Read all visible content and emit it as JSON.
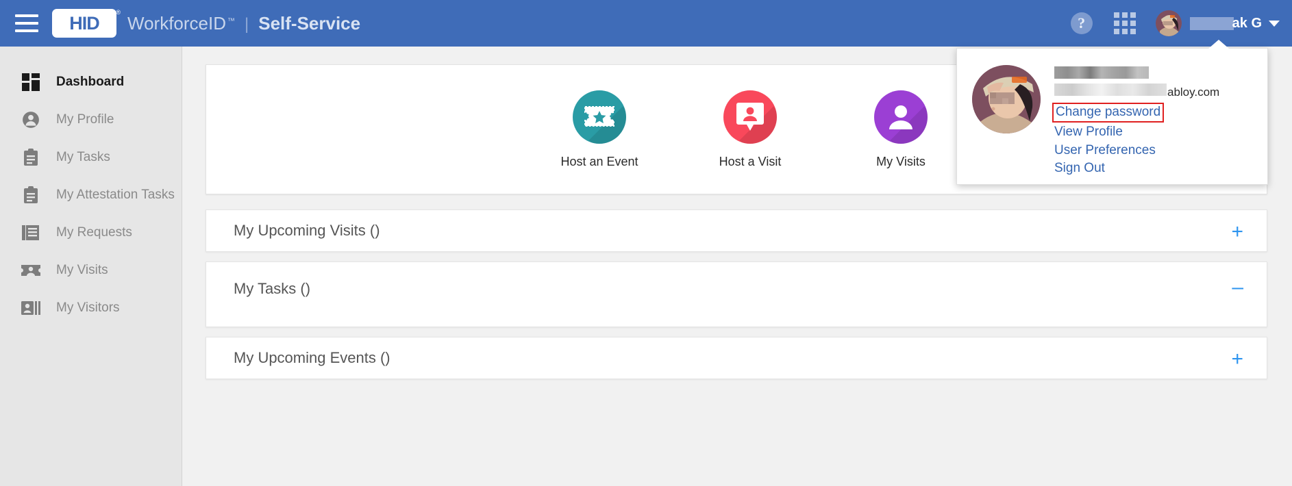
{
  "header": {
    "menu_icon": "hamburger-menu-icon",
    "logo_text": "HID",
    "logo_registered": "®",
    "product_name": "WorkforceID",
    "trademark": "™",
    "separator": "|",
    "subtitle": "Self-Service",
    "help_icon": "help-question-icon",
    "help_glyph": "?",
    "apps_icon": "apps-grid-icon",
    "avatar_icon": "user-avatar-image",
    "user_name_redacted": "",
    "user_name_visible": "ak G",
    "caret_icon": "chevron-down-icon"
  },
  "sidebar": {
    "items": [
      {
        "label": "Dashboard",
        "icon": "dashboard-grid-icon",
        "active": true
      },
      {
        "label": "My Profile",
        "icon": "person-circle-icon",
        "active": false
      },
      {
        "label": "My Tasks",
        "icon": "clipboard-icon",
        "active": false
      },
      {
        "label": "My Attestation Tasks",
        "icon": "clipboard-icon",
        "active": false
      },
      {
        "label": "My Requests",
        "icon": "documents-icon",
        "active": false
      },
      {
        "label": "My Visits",
        "icon": "badge-ticket-icon",
        "active": false
      },
      {
        "label": "My Visitors",
        "icon": "contact-card-icon",
        "active": false
      }
    ]
  },
  "main": {
    "tiles": [
      {
        "label": "Host an Event",
        "icon": "ticket-star-icon",
        "color": "#2a9ca5"
      },
      {
        "label": "Host a Visit",
        "icon": "visitor-badge-icon",
        "color": "#f9485b"
      },
      {
        "label": "My Visits",
        "icon": "person-icon",
        "color": "#9b3fd4"
      }
    ],
    "accordions": [
      {
        "title": "My Upcoming Visits ()",
        "state": "collapsed",
        "toggle": "+",
        "toggle_icon": "plus-icon"
      },
      {
        "title": "My Tasks ()",
        "state": "expanded",
        "toggle": "–",
        "toggle_icon": "minus-icon"
      },
      {
        "title": "My Upcoming Events ()",
        "state": "collapsed",
        "toggle": "+",
        "toggle_icon": "plus-icon"
      }
    ]
  },
  "dropdown": {
    "avatar_icon": "user-avatar-image",
    "name_redacted": "",
    "email_redacted": "",
    "email_visible": "abloy.com",
    "links": [
      {
        "label": "Change password",
        "highlighted": true
      },
      {
        "label": "View Profile",
        "highlighted": false
      },
      {
        "label": "User Preferences",
        "highlighted": false
      },
      {
        "label": "Sign Out",
        "highlighted": false
      }
    ]
  },
  "colors": {
    "header_blue": "#3f6cb8",
    "sidebar_bg": "#e6e6e6",
    "page_bg": "#f1f1f1",
    "link_blue": "#3465b0",
    "toggle_blue": "#2d94ef",
    "highlight_red": "#e02020",
    "tile_teal": "#2a9ca5",
    "tile_red": "#f9485b",
    "tile_purple": "#9b3fd4"
  }
}
